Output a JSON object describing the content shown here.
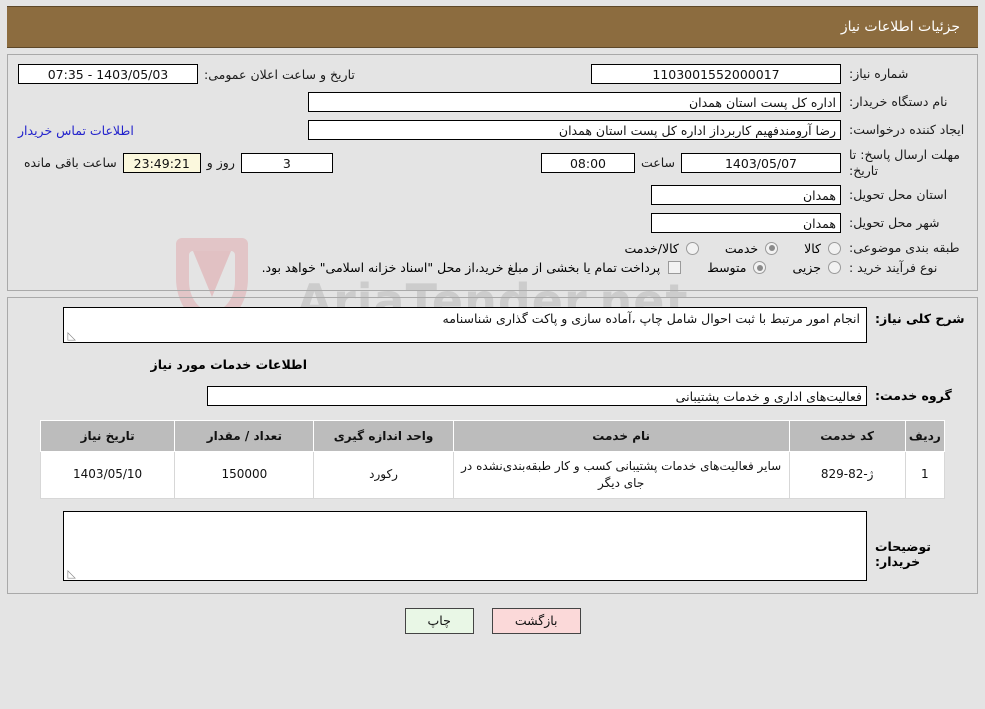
{
  "header": {
    "title": "جزئیات اطلاعات نیاز",
    "bg_color": "#8c6c3f"
  },
  "watermark": {
    "text": "AriaTender.net"
  },
  "top_form": {
    "need_number_label": "شماره نیاز:",
    "need_number_value": "1103001552000017",
    "announce_label": "تاریخ و ساعت اعلان عمومی:",
    "announce_value": "1403/05/03 - 07:35",
    "buyer_org_label": "نام دستگاه خریدار:",
    "buyer_org_value": "اداره کل پست استان همدان",
    "creator_label": "ایجاد کننده درخواست:",
    "creator_value": "رضا آرومندفهیم کاربرداز اداره کل پست استان همدان",
    "contact_link": "اطلاعات تماس خریدار",
    "deadline_label": "مهلت ارسال پاسخ: تا تاریخ:",
    "deadline_date": "1403/05/07",
    "hour_label": "ساعت",
    "deadline_time": "08:00",
    "days_value": "3",
    "days_label": "روز و",
    "countdown_value": "23:49:21",
    "countdown_label": "ساعت باقی مانده",
    "province_label": "استان محل تحویل:",
    "province_value": "همدان",
    "city_label": "شهر محل تحویل:",
    "city_value": "همدان",
    "category_label": "طبقه بندی موضوعی:",
    "category_options": [
      {
        "label": "کالا",
        "selected": false
      },
      {
        "label": "خدمت",
        "selected": true
      },
      {
        "label": "کالا/خدمت",
        "selected": false
      }
    ],
    "process_label": "نوع فرآیند خرید :",
    "process_options": [
      {
        "label": "جزیی",
        "selected": false
      },
      {
        "label": "متوسط",
        "selected": true
      }
    ],
    "treasury_checked": false,
    "treasury_note": "پرداخت تمام یا بخشی از مبلغ خرید،از محل \"اسناد خزانه اسلامی\" خواهد بود."
  },
  "middle": {
    "desc_label": "شرح کلی نیاز:",
    "desc_value": "انجام امور مرتبط با ثبت احوال شامل چاپ ،آماده سازی و پاکت گذاری شناسنامه",
    "section_title": "اطلاعات خدمات مورد نیاز",
    "group_label": "گروه خدمت:",
    "group_value": "فعالیت‌های اداری و خدمات پشتیبانی",
    "table": {
      "columns": [
        "ردیف",
        "کد خدمت",
        "نام خدمت",
        "واحد اندازه گیری",
        "تعداد / مقدار",
        "تاریخ نیاز"
      ],
      "rows": [
        {
          "radif": "1",
          "code": "ژ-82-829",
          "name": "سایر فعالیت‌های خدمات پشتیبانی کسب و کار طبقه‌بندی‌نشده در جای دیگر",
          "unit": "رکورد",
          "qty": "150000",
          "date": "1403/05/10"
        }
      ]
    },
    "comments_label": "توضیحات خریدار:",
    "comments_value": ""
  },
  "buttons": {
    "print": "چاپ",
    "back": "بازگشت"
  }
}
